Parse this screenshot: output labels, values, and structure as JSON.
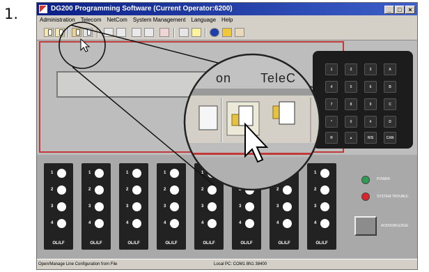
{
  "step": "1.",
  "window": {
    "title": "DG200 Programming Software (Current Operator:6200)",
    "controls": [
      "_",
      "□",
      "×"
    ]
  },
  "menu": [
    "Administration",
    "Telecom",
    "NetCom",
    "System Management",
    "Language",
    "Help"
  ],
  "toolbar": {
    "tools": [
      {
        "icon": "open-config-icon"
      },
      {
        "icon": "save-config-icon"
      },
      {
        "icon": "open-line-config-icon"
      },
      {
        "icon": "save-line-config-icon"
      },
      {
        "icon": "printer-icon"
      },
      {
        "icon": "print-preview-icon"
      },
      {
        "icon": "telephone-icon"
      },
      {
        "icon": "connect-icon"
      },
      {
        "icon": "alarm-icon"
      },
      {
        "icon": "screen-icon"
      },
      {
        "icon": "lightbulb-icon"
      },
      {
        "icon": "info-icon"
      },
      {
        "icon": "operator-icon"
      },
      {
        "icon": "exit-icon"
      }
    ]
  },
  "keypad": {
    "keys": [
      "1",
      "2",
      "3",
      "A",
      "4",
      "5",
      "6",
      "B",
      "7",
      "8",
      "9",
      "C",
      "*",
      "0",
      "#",
      "D",
      "R",
      "▲",
      "R/S",
      "CAN"
    ]
  },
  "zoom_callout": {
    "lcd_partial_text": [
      "on",
      "TeleC"
    ]
  },
  "loop_columns": {
    "led_numbers": [
      "1",
      "2",
      "3",
      "4"
    ],
    "label": "OL/LF",
    "count": 8
  },
  "indicators": {
    "power_label": "POWER",
    "trouble_label": "SYSTEM TROUBLE",
    "acknowledge_label": "ACKNOWLEDGE",
    "power_color": "#2e9c52",
    "trouble_color": "#d8262c"
  },
  "statusbar": {
    "left": "Open/Manage Line Configuration from File",
    "right": "Local PC:  COM1 8N1 38400"
  }
}
